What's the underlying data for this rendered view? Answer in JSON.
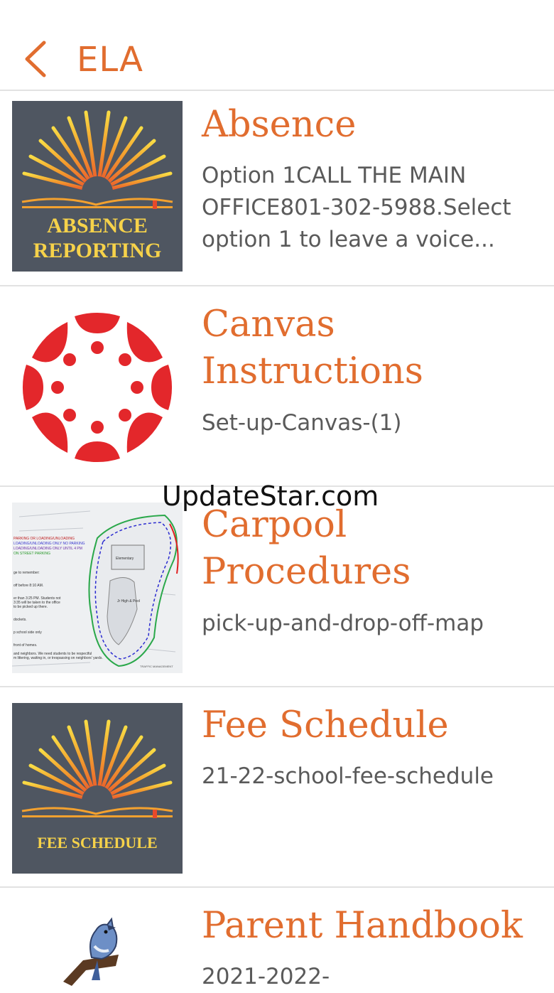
{
  "header": {
    "title": "ELA"
  },
  "watermark": "UpdateStar.com",
  "items": [
    {
      "title": "Absence",
      "desc": "Option 1CALL THE MAIN OFFICE801-302-5988.Select option 1 to leave a voice...",
      "thumb_text_line1": "ABSENCE",
      "thumb_text_line2": "REPORTING"
    },
    {
      "title_line1": "Canvas",
      "title_line2": "Instructions",
      "desc": "Set-up-Canvas-(1)"
    },
    {
      "title_line1": "Carpool",
      "title_line2": "Procedures",
      "desc": "pick-up-and-drop-off-map"
    },
    {
      "title": "Fee Schedule",
      "desc": "21-22-school-fee-schedule",
      "thumb_text": "FEE SCHEDULE"
    },
    {
      "title": "Parent Handbook",
      "desc": "2021-2022-"
    }
  ]
}
